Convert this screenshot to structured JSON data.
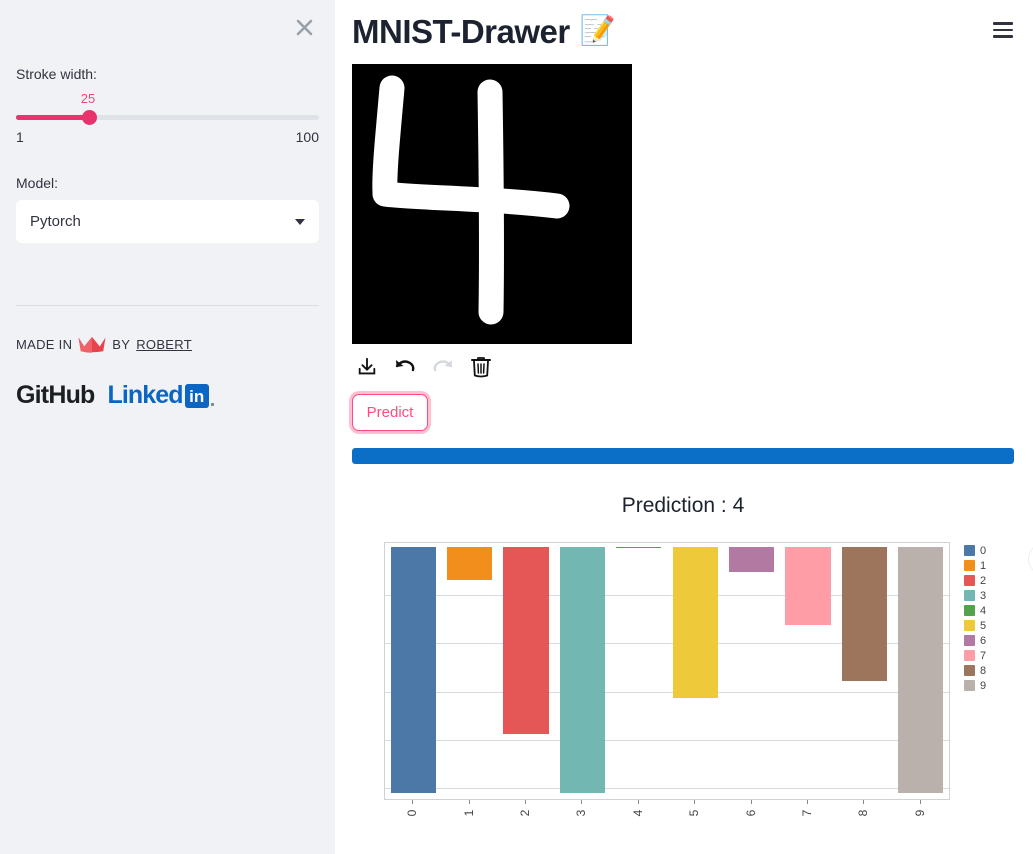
{
  "sidebar": {
    "close_icon": "close-icon",
    "stroke_width": {
      "label": "Stroke width:",
      "value": "25",
      "min": "1",
      "max": "100"
    },
    "model": {
      "label": "Model:",
      "selected": "Pytorch",
      "options": [
        "Pytorch"
      ]
    },
    "footer": {
      "made_in_prefix": "MADE IN",
      "crown_icon": "crown-icon",
      "by": "BY",
      "author": "ROBERT",
      "github_label": "GitHub",
      "linkedin_label": "Linked",
      "linkedin_mark": "in"
    }
  },
  "header": {
    "title": "MNIST-Drawer",
    "title_emoji": "📝",
    "menu_icon": "hamburger-menu-icon"
  },
  "canvas": {
    "drawn_digit": "4",
    "background_color": "#000000",
    "stroke_color": "#ffffff",
    "tools": [
      {
        "name": "download-icon",
        "label": "Download",
        "enabled": "true"
      },
      {
        "name": "undo-icon",
        "label": "Undo",
        "enabled": "true"
      },
      {
        "name": "redo-icon",
        "label": "Redo",
        "enabled": "false"
      },
      {
        "name": "trash-icon",
        "label": "Clear",
        "enabled": "true"
      }
    ]
  },
  "actions": {
    "predict_label": "Predict",
    "predict_color": "#ff4b7d"
  },
  "progress": {
    "percent": "100",
    "color": "#0c6fc7"
  },
  "result": {
    "prediction_text": "Prediction : 4"
  },
  "chart_options_icon": "more-options-icon",
  "chart_data": {
    "type": "bar",
    "title": "",
    "xlabel": "",
    "ylabel": "",
    "categories": [
      "0",
      "1",
      "2",
      "3",
      "4",
      "5",
      "6",
      "7",
      "8",
      "9"
    ],
    "values": [
      -25.5,
      -3.4,
      -19.4,
      -25.5,
      -0.1,
      -15.7,
      -2.6,
      -8.1,
      -13.9,
      -25.5
    ],
    "colors": [
      "#4c78a8",
      "#f28e1c",
      "#e45756",
      "#72b7b2",
      "#54a24b",
      "#eeca3b",
      "#b279a2",
      "#ff9da6",
      "#9d755d",
      "#bab0ac"
    ],
    "ylim": [
      -26.2,
      0.4
    ],
    "yticks": [
      "0",
      "-5",
      "-10",
      "-15",
      "-20",
      "-25"
    ],
    "ytick_values": [
      0,
      -5,
      -10,
      -15,
      -20,
      -25
    ],
    "grid": "y",
    "legend": {
      "position": "right",
      "entries": [
        "0",
        "1",
        "2",
        "3",
        "4",
        "5",
        "6",
        "7",
        "8",
        "9"
      ]
    }
  }
}
